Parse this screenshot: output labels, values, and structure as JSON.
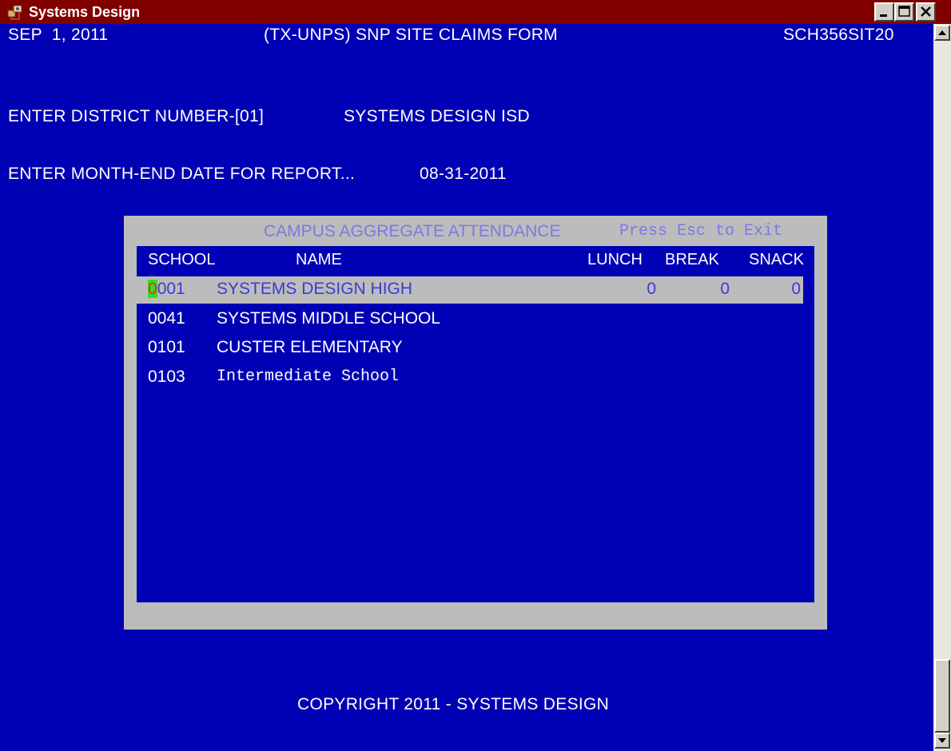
{
  "window": {
    "title": "Systems Design"
  },
  "screen": {
    "date": "SEP  1, 2011",
    "form_title": "(TX-UNPS) SNP SITE CLAIMS FORM",
    "program_id": "SCH356SIT20",
    "district_prompt": "ENTER DISTRICT NUMBER-[01]",
    "district_name": "SYSTEMS DESIGN ISD",
    "month_end_prompt": "ENTER MONTH-END DATE FOR REPORT...",
    "month_end_date": "08-31-2011",
    "copyright": "COPYRIGHT 2011 - SYSTEMS DESIGN"
  },
  "popup": {
    "title": "CAMPUS AGGREGATE ATTENDANCE",
    "hint": "Press Esc to Exit",
    "columns": {
      "school": "SCHOOL",
      "name": "NAME",
      "lunch": "LUNCH",
      "break": "BREAK",
      "snack": "SNACK"
    },
    "rows": [
      {
        "cursor_char": "0",
        "school_rest": "001",
        "school": "0001",
        "name": "SYSTEMS DESIGN HIGH",
        "lunch": "0",
        "break": "0",
        "snack": "0"
      },
      {
        "school": "0041",
        "name": "SYSTEMS MIDDLE SCHOOL",
        "lunch": "",
        "break": "",
        "snack": ""
      },
      {
        "school": "0101",
        "name": "CUSTER ELEMENTARY",
        "lunch": "",
        "break": "",
        "snack": ""
      },
      {
        "school": "0103",
        "name": "Intermediate School",
        "lunch": "",
        "break": "",
        "snack": ""
      }
    ]
  },
  "colors": {
    "terminal_bg": "#0000b4",
    "titlebar_bg": "#800000",
    "panel_bg": "#bcbcbc",
    "panel_title": "#7a7ae6",
    "cursor_bg": "#33dd22",
    "cursor_fg": "#ff2222"
  },
  "icons": [
    "app-icon",
    "minimize-icon",
    "maximize-icon",
    "close-icon",
    "scroll-up-icon",
    "scroll-down-icon"
  ]
}
